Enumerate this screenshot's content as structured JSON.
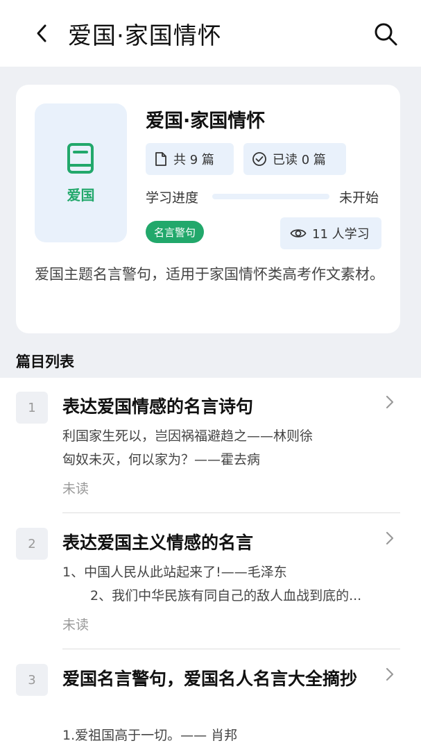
{
  "header": {
    "title": "爱国·家国情怀",
    "back_icon": "chevron-left-icon",
    "search_icon": "search-icon"
  },
  "card": {
    "cover_label": "爱国",
    "cover_icon": "book-icon",
    "title": "爱国·家国情怀",
    "total_label": "共 9 篇",
    "read_label": "已读 0 篇",
    "progress_label": "学习进度",
    "progress_value": 0,
    "progress_status": "未开始",
    "tag": "名言警句",
    "learners_label": "11 人学习",
    "description": "爱国主题名言警句，适用于家国情怀类高考作文素材。"
  },
  "section_title": "篇目列表",
  "items": [
    {
      "num": "1",
      "title": "表达爱国情感的名言诗句",
      "lines": [
        "利国家生死以，岂因祸福避趋之——林则徐",
        "匈奴未灭，何以家为？——霍去病"
      ],
      "status": "未读"
    },
    {
      "num": "2",
      "title": "表达爱国主义情感的名言",
      "lines": [
        "1、中国人民从此站起来了!——毛泽东",
        "2、我们中华民族有同自己的敌人血战到底的..."
      ],
      "status": "未读"
    },
    {
      "num": "3",
      "title": "爱国名言警句，爱国名人名言大全摘抄",
      "lines": [
        "1.爱祖国高于一切。—— 肖邦"
      ],
      "status": ""
    }
  ],
  "colors": {
    "accent": "#22a86b",
    "chip_bg": "#e9f1fb",
    "page_bg": "#eef0f4"
  }
}
